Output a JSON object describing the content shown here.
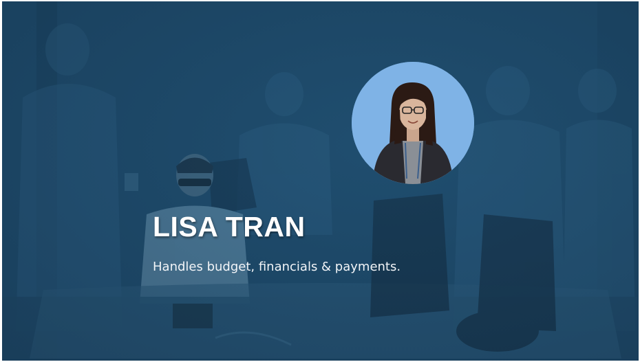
{
  "slide": {
    "name": "LISA TRAN",
    "role": "Handles budget, financials & payments."
  },
  "colors": {
    "overlay": "#1d4868",
    "avatar_bg": "#7fb3e6",
    "text": "#ffffff"
  },
  "icons": {
    "avatar": "portrait-photo"
  }
}
